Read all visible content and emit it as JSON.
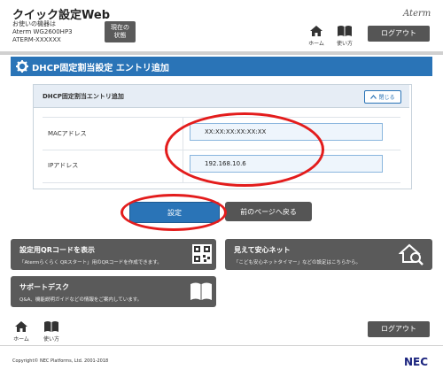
{
  "header": {
    "app_title": "クイック設定Web",
    "device_caption": "お使いの機器は",
    "device_model": "Aterm WG2600HP3",
    "device_name": "ATERM-XXXXXX",
    "current_state_line1": "現在の",
    "current_state_line2": "状態",
    "brand": "Aterm",
    "home_label": "ホーム",
    "howto_label": "使い方",
    "logout_label": "ログアウト"
  },
  "page": {
    "title": "DHCP固定割当設定 エントリ追加",
    "panel_title": "DHCP固定割当エントリ追加",
    "close_label": "閉じる"
  },
  "form": {
    "mac_label": "MACアドレス",
    "mac_value": "XX:XX:XX:XX:XX:XX",
    "ip_label": "IPアドレス",
    "ip_value": "192.168.10.6"
  },
  "actions": {
    "set_label": "設定",
    "back_label": "前のページへ戻る"
  },
  "tiles": {
    "qr_title": "設定用QRコードを表示",
    "qr_desc": "「Atermらくらく QRスタート」用のQRコードを作成できます。",
    "safe_title": "見えて安心ネット",
    "safe_desc": "「こども安心ネットタイマー」などの設定はこちらから。",
    "support_title": "サポートデスク",
    "support_desc": "Q&A、機能説明ガイドなどの情報をご案内しています。"
  },
  "footer": {
    "home_label": "ホーム",
    "howto_label": "使い方",
    "logout_label": "ログアウト",
    "copyright": "Copyright© NEC Platforms, Ltd. 2001-2018",
    "nec": "NEC"
  },
  "colors": {
    "accent_blue": "#2a74b7",
    "dark_gray": "#555555",
    "highlight_red": "#e31c1c"
  },
  "icons": [
    "gear-icon",
    "home-icon",
    "book-icon",
    "qr-icon",
    "house-search-icon"
  ]
}
